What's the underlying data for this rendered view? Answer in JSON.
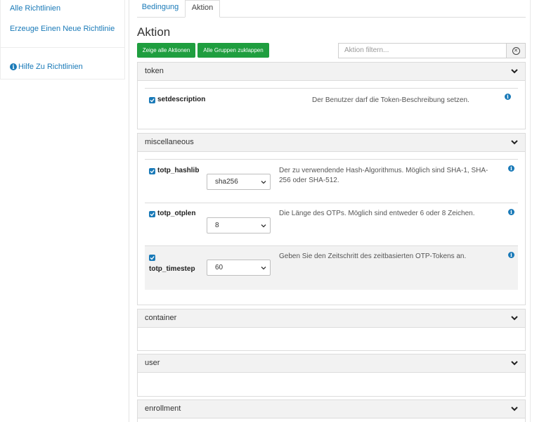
{
  "sidebar": {
    "items": [
      {
        "label": "Alle Richtlinien"
      },
      {
        "label": "Erzeuge Einen Neue Richtlinie"
      },
      {
        "label": "Hilfe Zu Richtlinien"
      }
    ]
  },
  "tabs": [
    {
      "label": "Bedingung",
      "active": false
    },
    {
      "label": "Aktion",
      "active": true
    }
  ],
  "page_title": "Aktion",
  "buttons": {
    "show_all": "Zeige alle Aktionen",
    "collapse_all": "Alle Gruppen zuklappen"
  },
  "filter": {
    "placeholder": "Aktion filtern..."
  },
  "groups": {
    "token": {
      "title": "token",
      "options": [
        {
          "name": "setdescription",
          "checked": true,
          "description": "Der Benutzer darf die Token-Beschreibung setzen."
        }
      ]
    },
    "miscellaneous": {
      "title": "miscellaneous",
      "options": [
        {
          "name": "totp_hashlib",
          "checked": true,
          "value": "sha256",
          "description": "Der zu verwendende Hash-Algorithmus. Möglich sind SHA-1, SHA-256 oder SHA-512."
        },
        {
          "name": "totp_otplen",
          "checked": true,
          "value": "8",
          "description": "Die Länge des OTPs. Möglich sind entweder 6 oder 8 Zeichen."
        },
        {
          "name": "totp_timestep",
          "checked": true,
          "value": "60",
          "description": "Geben Sie den Zeitschritt des zeitbasierten OTP-Tokens an."
        }
      ]
    },
    "container": {
      "title": "container"
    },
    "user": {
      "title": "user"
    },
    "enrollment": {
      "title": "enrollment"
    }
  },
  "colors": {
    "accent": "#1a7ab8",
    "button_green": "#1f9e3f",
    "panel_header": "#f2f2f2"
  }
}
